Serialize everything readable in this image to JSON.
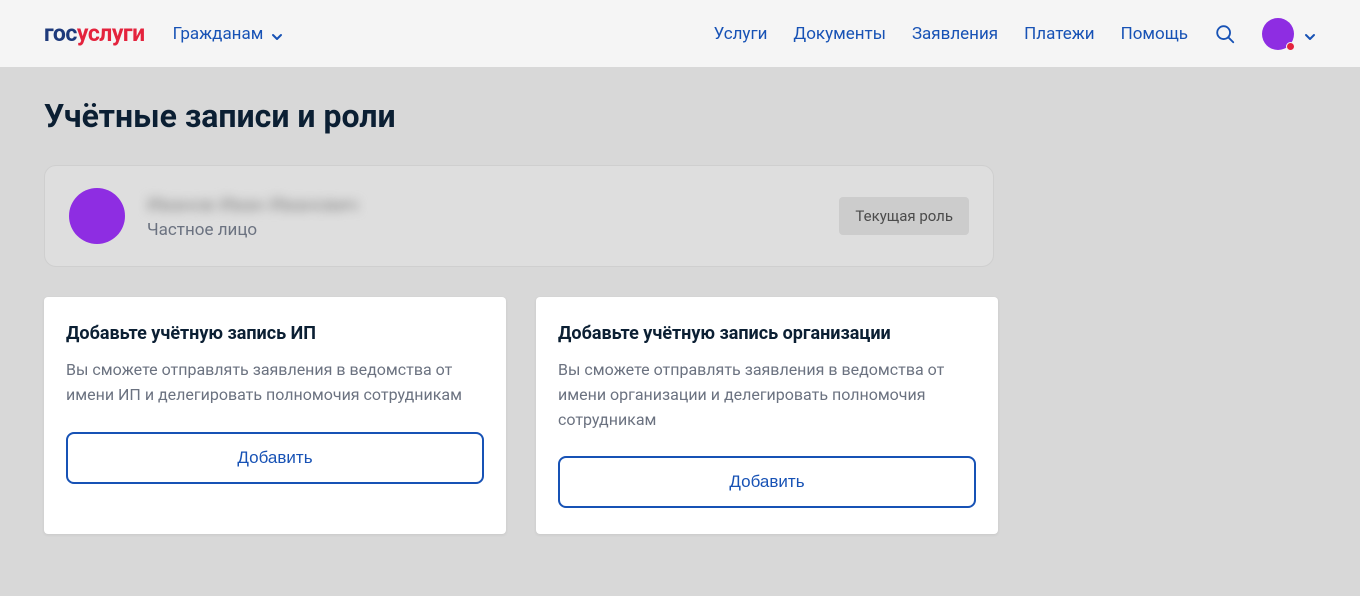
{
  "header": {
    "logo": {
      "part1": "гос",
      "part2": "услуги"
    },
    "audience": "Гражданам",
    "nav": {
      "services": "Услуги",
      "documents": "Документы",
      "applications": "Заявления",
      "payments": "Платежи",
      "help": "Помощь"
    }
  },
  "page": {
    "title": "Учётные записи и роли"
  },
  "currentRole": {
    "name": "Иванов Иван Иванович",
    "type": "Частное лицо",
    "badge": "Текущая роль"
  },
  "cards": {
    "ip": {
      "title": "Добавьте учётную запись ИП",
      "desc": "Вы сможете отправлять заявления в ведомства от имени ИП и делегировать полномочия сотрудникам",
      "button": "Добавить"
    },
    "org": {
      "title": "Добавьте учётную запись организации",
      "desc": "Вы сможете отправлять заявления в ведомства от имени организации и делегировать полномочия сотрудникам",
      "button": "Добавить"
    }
  }
}
